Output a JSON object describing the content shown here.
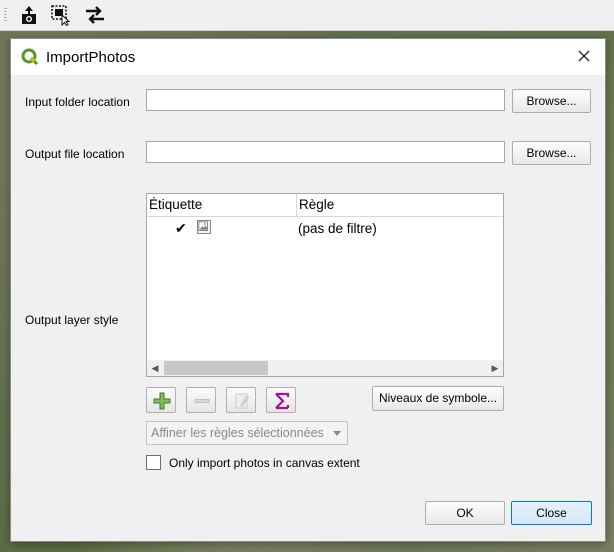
{
  "toolbar": {
    "icons": [
      "add-photo-icon",
      "select-features-icon",
      "swap-arrows-icon"
    ]
  },
  "dialog": {
    "title": "ImportPhotos",
    "input_folder_label": "Input folder location",
    "input_folder_value": "",
    "output_file_label": "Output file location",
    "output_file_value": "",
    "browse_label": "Browse...",
    "output_style_label": "Output layer style",
    "rules_tree": {
      "columns": [
        "Étiquette",
        "Règle"
      ],
      "rows": [
        {
          "checked": true,
          "rule": "(pas de filtre)"
        }
      ]
    },
    "symbol_levels_label": "Niveaux de symbole...",
    "refine_rules_label": "Affiner les règles sélectionnées",
    "canvas_extent_label": "Only import photos in canvas extent",
    "canvas_extent_checked": false,
    "ok_label": "OK",
    "close_label": "Close"
  },
  "colors": {
    "qgis_green": "#589632",
    "sigma_purple": "#a0138e",
    "primary_border": "#0078d7"
  }
}
